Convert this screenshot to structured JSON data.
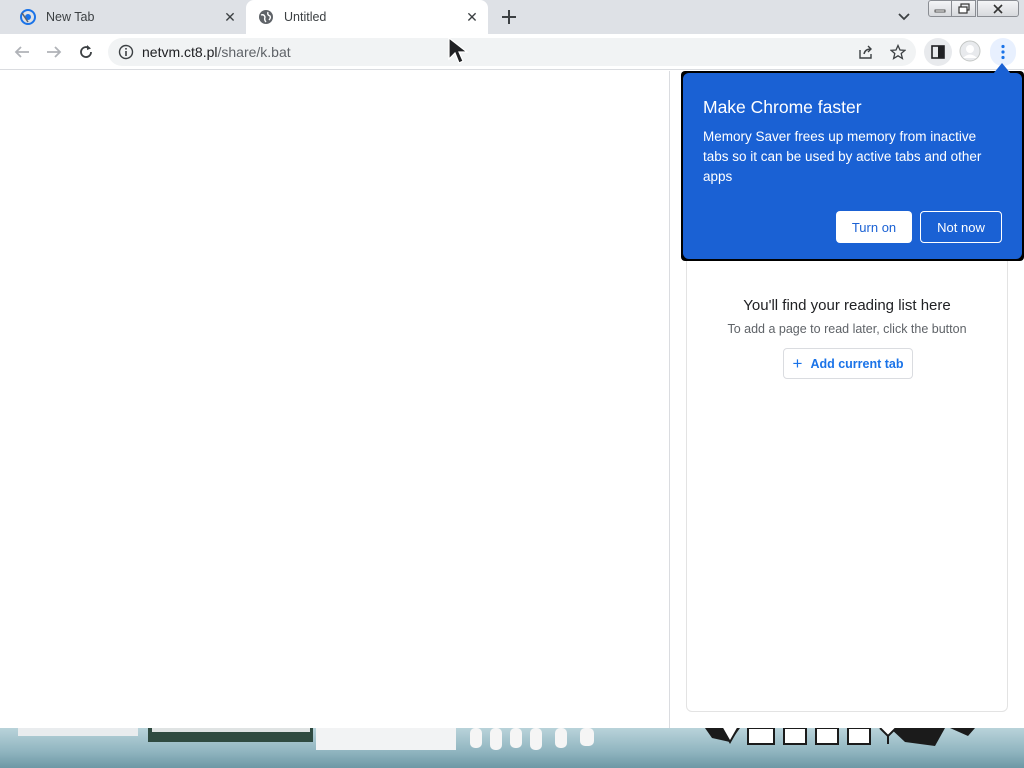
{
  "tabs": [
    {
      "title": "New Tab",
      "icon": "chrome-newtab-icon",
      "active": false
    },
    {
      "title": "Untitled",
      "icon": "globe-icon",
      "active": true
    }
  ],
  "toolbar": {
    "url_host": "netvm.ct8.pl",
    "url_path": "/share/k.bat"
  },
  "iph": {
    "title": "Make Chrome faster",
    "body": "Memory Saver frees up memory from inactive tabs so it can be used by active tabs and other apps",
    "turn_on": "Turn on",
    "not_now": "Not now",
    "background_color": "#1a61d4"
  },
  "reading_list": {
    "title": "You'll find your reading list here",
    "subtitle": "To add a page to read later, click the button",
    "add_button": "Add current tab"
  },
  "colors": {
    "tabstrip": "#dee1e6",
    "accent": "#1a73e8"
  }
}
